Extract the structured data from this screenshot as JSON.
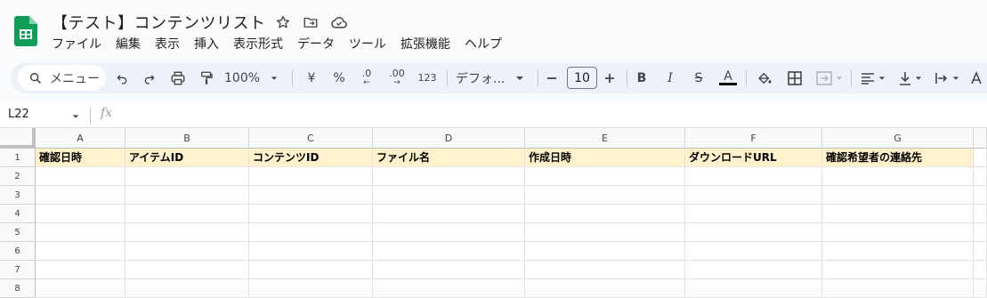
{
  "document": {
    "title": "【テスト】コンテンツリスト"
  },
  "title_icons": [
    "star-icon",
    "move-to-folder-icon",
    "cloud-saved-icon"
  ],
  "menu": [
    "ファイル",
    "編集",
    "表示",
    "挿入",
    "表示形式",
    "データ",
    "ツール",
    "拡張機能",
    "ヘルプ"
  ],
  "toolbar": {
    "search_label": "メニュー",
    "zoom": "100%",
    "currency": "¥",
    "percent": "%",
    "decrease_decimal": ".0",
    "increase_decimal": ".00",
    "number_format": "123",
    "font": "デフォ...",
    "font_size": "10",
    "bold": "B",
    "italic": "I",
    "strikethrough": "S",
    "text_color": "A",
    "text_color_hex": "#000000"
  },
  "formula_bar": {
    "name_box": "L22",
    "fx": "fx",
    "value": ""
  },
  "sheet": {
    "columns": [
      "A",
      "B",
      "C",
      "D",
      "E",
      "F",
      "G"
    ],
    "rows": [
      "1",
      "2",
      "3",
      "4",
      "5",
      "6",
      "7",
      "8"
    ],
    "header_row": [
      "確認日時",
      "アイテムID",
      "コンテンツID",
      "ファイル名",
      "作成日時",
      "ダウンロードURL",
      "確認希望者の連絡先"
    ],
    "header_fill": "#fff2cc"
  },
  "colors": {
    "sheets_green": "#0f9d58",
    "toolbar_bg": "#edf2fa"
  }
}
